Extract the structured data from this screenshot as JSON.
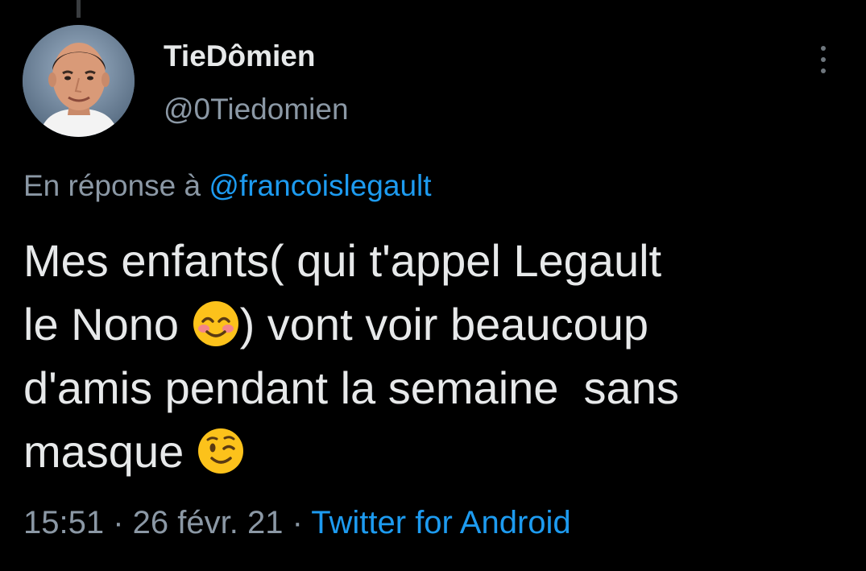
{
  "tweet": {
    "author": {
      "display_name": "TieDômien",
      "handle": "@0Tiedomien"
    },
    "reply_context": {
      "prefix": "En réponse à ",
      "mention": "@francoislegault"
    },
    "text_lines": {
      "line1": "Mes enfants( qui t'appel Legault",
      "line2a": "le Nono ",
      "emoji1": "smiling-face-with-smiling-eyes",
      "line2b": ") vont voir beaucoup",
      "line3": "d'amis pendant la semaine  sans",
      "line4a": "masque ",
      "emoji2": "winking-face"
    },
    "meta": {
      "time": "15:51",
      "separator1": " · ",
      "date": "26 févr. 21",
      "separator2": " · ",
      "source": "Twitter for Android"
    }
  },
  "icons": {
    "more": "vertical-ellipsis-icon"
  },
  "colors": {
    "background": "#000000",
    "primary_text": "#e7e9ea",
    "secondary_text": "#8b98a5",
    "link": "#1d9bf0"
  }
}
